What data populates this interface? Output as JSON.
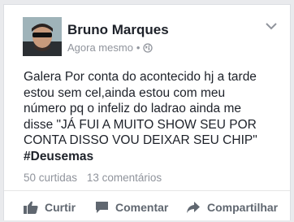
{
  "post": {
    "author": "Bruno Marques",
    "timestamp": "Agora mesmo",
    "separator": "•",
    "privacy_icon": "globe-icon",
    "text_lines": [
      "Galera Por conta do acontecido hj a tarde",
      "estou sem cel,ainda estou com meu",
      "número pq o infeliz do ladrao ainda me",
      "disse \"JÁ FUI A MUITO SHOW SEU POR",
      "CONTA DISSO VOU DEIXAR SEU CHIP\""
    ],
    "hashtag": "#Deusemas"
  },
  "stats": {
    "likes": "50 curtidas",
    "comments": "13 comentários"
  },
  "actions": {
    "like_label": "Curtir",
    "comment_label": "Comentar",
    "share_label": "Compartilhar"
  },
  "colors": {
    "text": "#1d2129",
    "secondary": "#90949c",
    "action": "#606770",
    "background": "#e9eaed"
  }
}
